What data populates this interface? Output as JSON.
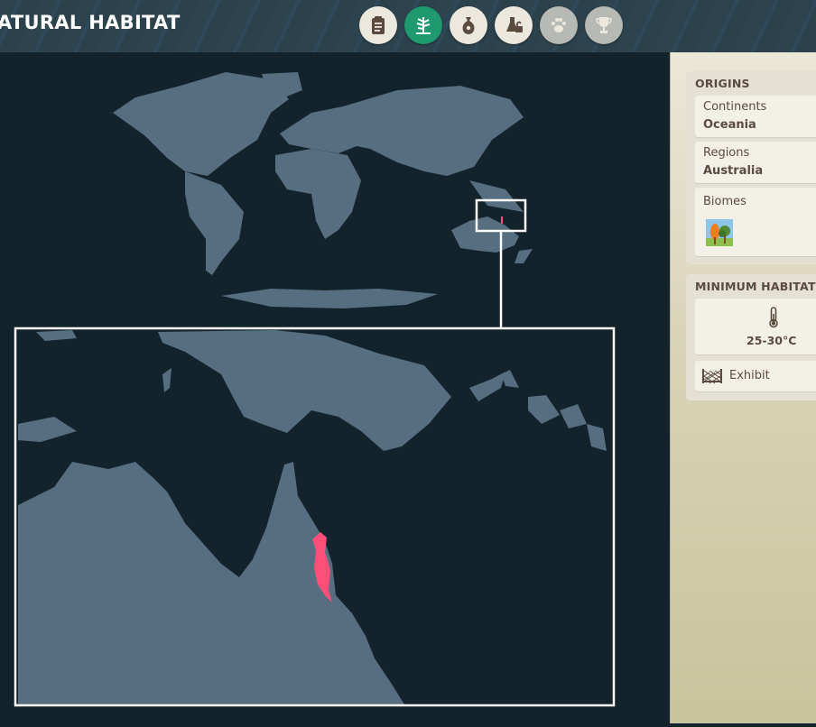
{
  "header": {
    "title": "ATURAL HABITAT"
  },
  "tabs": [
    {
      "icon": "clipboard-icon",
      "state": "normal"
    },
    {
      "icon": "habitat-icon",
      "state": "active"
    },
    {
      "icon": "food-sack-icon",
      "state": "normal"
    },
    {
      "icon": "enrichment-lock-icon",
      "state": "normal"
    },
    {
      "icon": "paw-icon",
      "state": "disabled"
    },
    {
      "icon": "trophy-icon",
      "state": "disabled"
    }
  ],
  "origins": {
    "heading": "ORIGINS",
    "continents": {
      "label": "Continents",
      "value": "Oceania"
    },
    "regions": {
      "label": "Regions",
      "value": "Australia"
    },
    "biomes": {
      "label": "Biomes",
      "icon": "tropical-forest-biome-icon"
    }
  },
  "minimum_habitat": {
    "heading": "MINIMUM HABITAT I",
    "temperature": {
      "icon": "thermometer-icon",
      "value": "25-30°C"
    },
    "barrier": {
      "icon": "fence-icon",
      "label": "Exhibit"
    }
  },
  "colors": {
    "accent": "#1f9a6e",
    "land": "#566e80",
    "range": "#ff4f78",
    "sea": "#13232b"
  }
}
